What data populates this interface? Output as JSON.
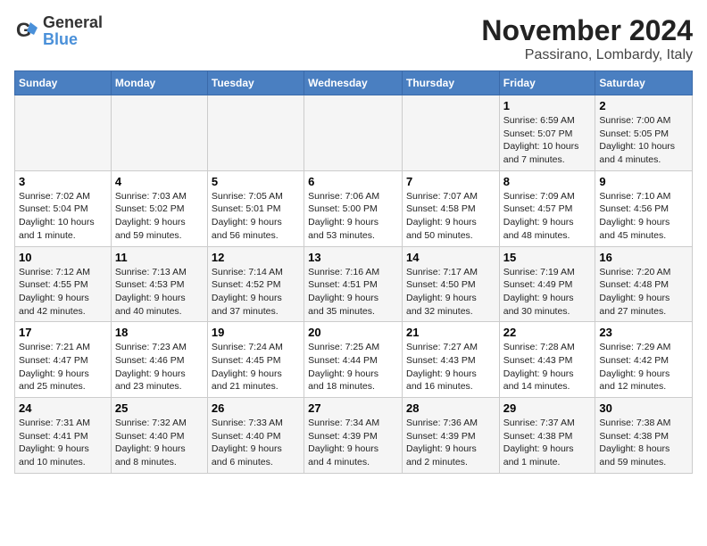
{
  "logo": {
    "text_general": "General",
    "text_blue": "Blue"
  },
  "title": "November 2024",
  "subtitle": "Passirano, Lombardy, Italy",
  "headers": [
    "Sunday",
    "Monday",
    "Tuesday",
    "Wednesday",
    "Thursday",
    "Friday",
    "Saturday"
  ],
  "weeks": [
    [
      {
        "day": "",
        "info": ""
      },
      {
        "day": "",
        "info": ""
      },
      {
        "day": "",
        "info": ""
      },
      {
        "day": "",
        "info": ""
      },
      {
        "day": "",
        "info": ""
      },
      {
        "day": "1",
        "info": "Sunrise: 6:59 AM\nSunset: 5:07 PM\nDaylight: 10 hours\nand 7 minutes."
      },
      {
        "day": "2",
        "info": "Sunrise: 7:00 AM\nSunset: 5:05 PM\nDaylight: 10 hours\nand 4 minutes."
      }
    ],
    [
      {
        "day": "3",
        "info": "Sunrise: 7:02 AM\nSunset: 5:04 PM\nDaylight: 10 hours\nand 1 minute."
      },
      {
        "day": "4",
        "info": "Sunrise: 7:03 AM\nSunset: 5:02 PM\nDaylight: 9 hours\nand 59 minutes."
      },
      {
        "day": "5",
        "info": "Sunrise: 7:05 AM\nSunset: 5:01 PM\nDaylight: 9 hours\nand 56 minutes."
      },
      {
        "day": "6",
        "info": "Sunrise: 7:06 AM\nSunset: 5:00 PM\nDaylight: 9 hours\nand 53 minutes."
      },
      {
        "day": "7",
        "info": "Sunrise: 7:07 AM\nSunset: 4:58 PM\nDaylight: 9 hours\nand 50 minutes."
      },
      {
        "day": "8",
        "info": "Sunrise: 7:09 AM\nSunset: 4:57 PM\nDaylight: 9 hours\nand 48 minutes."
      },
      {
        "day": "9",
        "info": "Sunrise: 7:10 AM\nSunset: 4:56 PM\nDaylight: 9 hours\nand 45 minutes."
      }
    ],
    [
      {
        "day": "10",
        "info": "Sunrise: 7:12 AM\nSunset: 4:55 PM\nDaylight: 9 hours\nand 42 minutes."
      },
      {
        "day": "11",
        "info": "Sunrise: 7:13 AM\nSunset: 4:53 PM\nDaylight: 9 hours\nand 40 minutes."
      },
      {
        "day": "12",
        "info": "Sunrise: 7:14 AM\nSunset: 4:52 PM\nDaylight: 9 hours\nand 37 minutes."
      },
      {
        "day": "13",
        "info": "Sunrise: 7:16 AM\nSunset: 4:51 PM\nDaylight: 9 hours\nand 35 minutes."
      },
      {
        "day": "14",
        "info": "Sunrise: 7:17 AM\nSunset: 4:50 PM\nDaylight: 9 hours\nand 32 minutes."
      },
      {
        "day": "15",
        "info": "Sunrise: 7:19 AM\nSunset: 4:49 PM\nDaylight: 9 hours\nand 30 minutes."
      },
      {
        "day": "16",
        "info": "Sunrise: 7:20 AM\nSunset: 4:48 PM\nDaylight: 9 hours\nand 27 minutes."
      }
    ],
    [
      {
        "day": "17",
        "info": "Sunrise: 7:21 AM\nSunset: 4:47 PM\nDaylight: 9 hours\nand 25 minutes."
      },
      {
        "day": "18",
        "info": "Sunrise: 7:23 AM\nSunset: 4:46 PM\nDaylight: 9 hours\nand 23 minutes."
      },
      {
        "day": "19",
        "info": "Sunrise: 7:24 AM\nSunset: 4:45 PM\nDaylight: 9 hours\nand 21 minutes."
      },
      {
        "day": "20",
        "info": "Sunrise: 7:25 AM\nSunset: 4:44 PM\nDaylight: 9 hours\nand 18 minutes."
      },
      {
        "day": "21",
        "info": "Sunrise: 7:27 AM\nSunset: 4:43 PM\nDaylight: 9 hours\nand 16 minutes."
      },
      {
        "day": "22",
        "info": "Sunrise: 7:28 AM\nSunset: 4:43 PM\nDaylight: 9 hours\nand 14 minutes."
      },
      {
        "day": "23",
        "info": "Sunrise: 7:29 AM\nSunset: 4:42 PM\nDaylight: 9 hours\nand 12 minutes."
      }
    ],
    [
      {
        "day": "24",
        "info": "Sunrise: 7:31 AM\nSunset: 4:41 PM\nDaylight: 9 hours\nand 10 minutes."
      },
      {
        "day": "25",
        "info": "Sunrise: 7:32 AM\nSunset: 4:40 PM\nDaylight: 9 hours\nand 8 minutes."
      },
      {
        "day": "26",
        "info": "Sunrise: 7:33 AM\nSunset: 4:40 PM\nDaylight: 9 hours\nand 6 minutes."
      },
      {
        "day": "27",
        "info": "Sunrise: 7:34 AM\nSunset: 4:39 PM\nDaylight: 9 hours\nand 4 minutes."
      },
      {
        "day": "28",
        "info": "Sunrise: 7:36 AM\nSunset: 4:39 PM\nDaylight: 9 hours\nand 2 minutes."
      },
      {
        "day": "29",
        "info": "Sunrise: 7:37 AM\nSunset: 4:38 PM\nDaylight: 9 hours\nand 1 minute."
      },
      {
        "day": "30",
        "info": "Sunrise: 7:38 AM\nSunset: 4:38 PM\nDaylight: 8 hours\nand 59 minutes."
      }
    ]
  ]
}
